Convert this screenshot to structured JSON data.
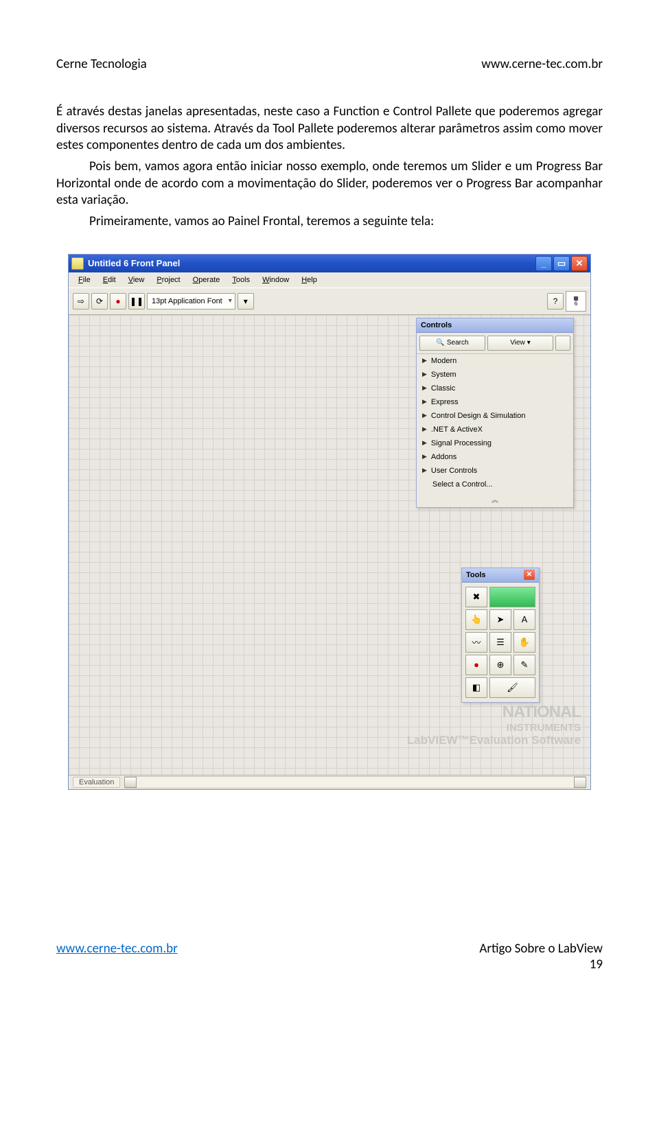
{
  "header": {
    "left": "Cerne Tecnologia",
    "right": "www.cerne-tec.com.br"
  },
  "body": {
    "p1": "É através destas janelas apresentadas, neste caso a Function e Control Pallete que poderemos agregar diversos recursos ao sistema. Através da Tool Pallete poderemos alterar parâmetros assim como mover estes componentes dentro de cada um dos ambientes.",
    "p2": "Pois bem, vamos agora então iniciar nosso exemplo, onde teremos um Slider e um Progress Bar Horizontal onde de acordo com a movimentação do Slider, poderemos ver o Progress Bar acompanhar esta variação.",
    "p3": "Primeiramente, vamos ao Painel Frontal, teremos a seguinte tela:"
  },
  "window": {
    "title": "Untitled 6 Front Panel",
    "menu": [
      "File",
      "Edit",
      "View",
      "Project",
      "Operate",
      "Tools",
      "Window",
      "Help"
    ],
    "font": "13pt Application Font",
    "status": "Evaluation",
    "vi_badge": "6"
  },
  "controls_palette": {
    "title": "Controls",
    "search": "Search",
    "view": "View",
    "items": [
      "Modern",
      "System",
      "Classic",
      "Express",
      "Control Design & Simulation",
      ".NET & ActiveX",
      "Signal Processing",
      "Addons",
      "User Controls",
      "Select a Control..."
    ]
  },
  "tools_palette": {
    "title": "Tools"
  },
  "watermark": {
    "l1": "NATIONAL",
    "l2": "INSTRUMENTS",
    "l3": "LabVIEW™Evaluation Software"
  },
  "footer": {
    "link": "www.cerne-tec.com.br",
    "right": "Artigo Sobre o LabView",
    "page": "19"
  }
}
